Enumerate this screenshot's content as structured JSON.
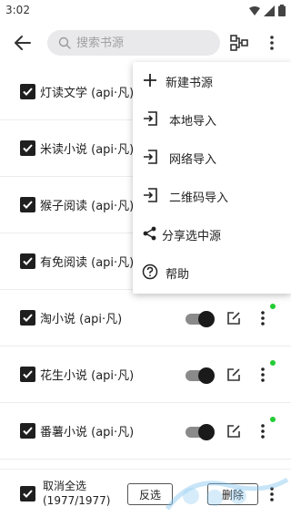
{
  "status_bar": {
    "time": "3:02"
  },
  "search": {
    "placeholder": "搜索书源"
  },
  "sources": [
    {
      "name": "灯读文学 (api·凡)"
    },
    {
      "name": "米读小说 (api·凡)"
    },
    {
      "name": "猴子阅读 (api·凡)"
    },
    {
      "name": "有免阅读 (api·凡)"
    },
    {
      "name": "淘小说 (api·凡)"
    },
    {
      "name": "花生小说 (api·凡)"
    },
    {
      "name": "番薯小说 (api·凡)"
    }
  ],
  "menu": {
    "items": [
      {
        "label": "新建书源",
        "icon": "plus-icon"
      },
      {
        "label": "本地导入",
        "icon": "import-icon"
      },
      {
        "label": "网络导入",
        "icon": "import-icon"
      },
      {
        "label": "二维码导入",
        "icon": "import-icon"
      },
      {
        "label": "分享选中源",
        "icon": "share-icon"
      },
      {
        "label": "帮助",
        "icon": "help-icon"
      }
    ]
  },
  "bottom": {
    "select_all_line1": "取消全选",
    "select_all_line2": "(1977/1977)",
    "invert_label": "反选",
    "delete_label": "删除"
  },
  "colors": {
    "toggle_on": "#1a1a1a",
    "enabled_dot": "#22cc33"
  }
}
